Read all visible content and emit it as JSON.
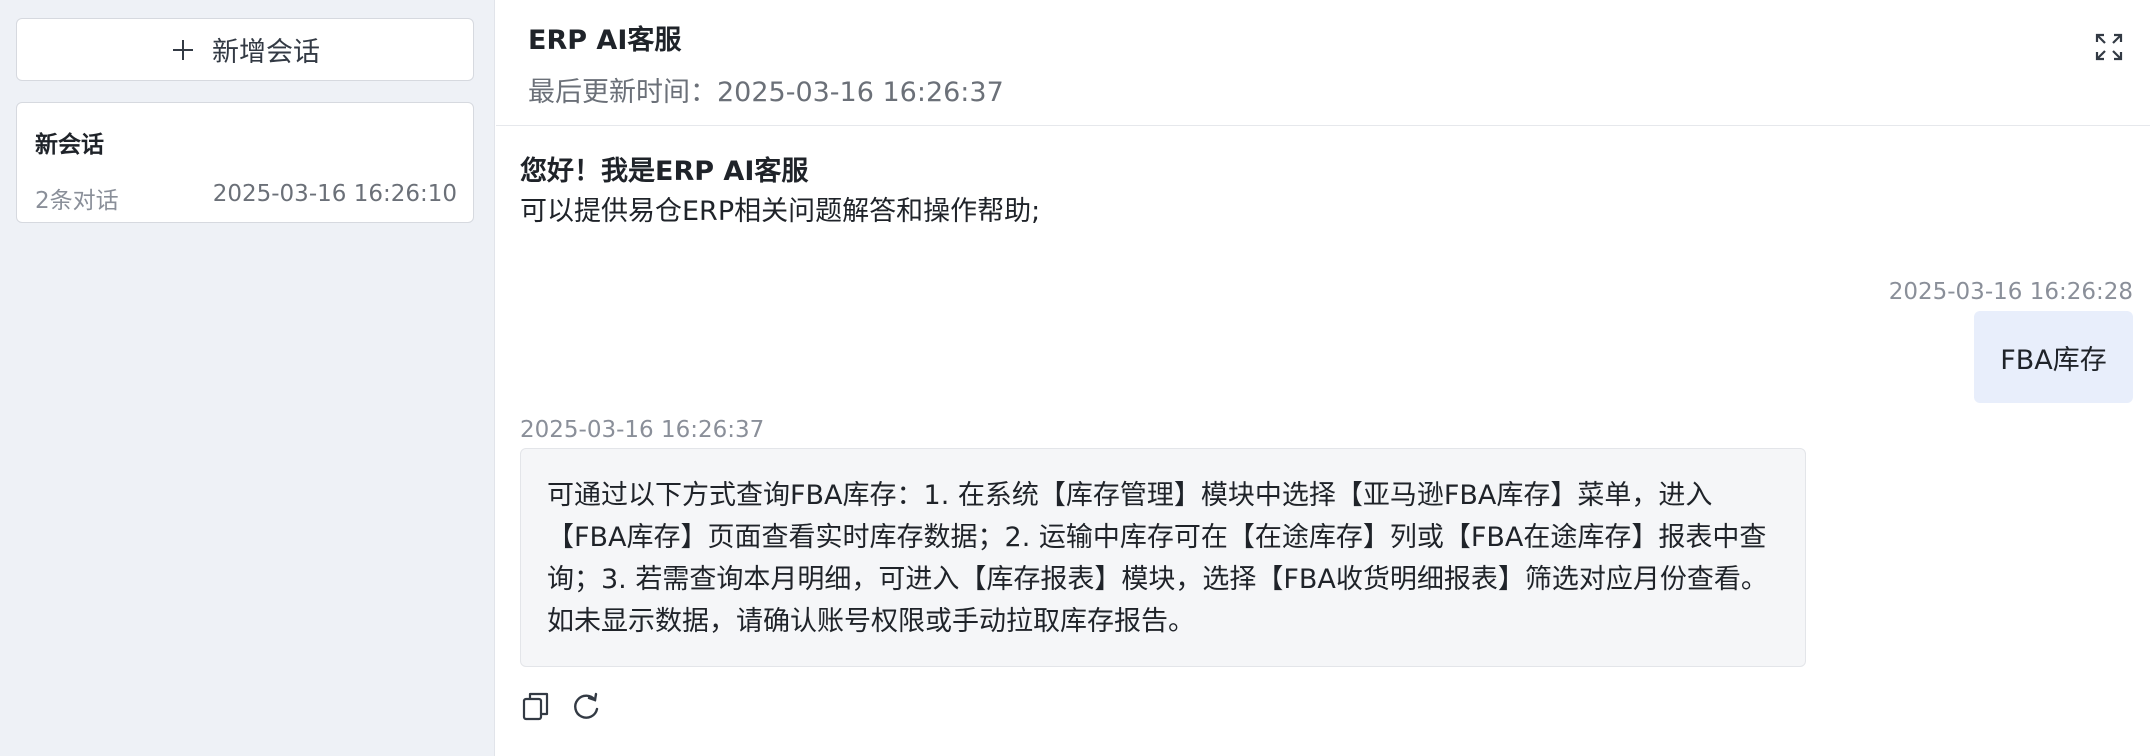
{
  "sidebar": {
    "new_chat_label": "新增会话",
    "sessions": [
      {
        "title": "新会话",
        "count_text": "2条对话",
        "time": "2025-03-16 16:26:10"
      }
    ]
  },
  "header": {
    "title": "ERP AI客服",
    "updated_label": "最后更新时间：",
    "updated_time": "2025-03-16 16:26:37"
  },
  "chat": {
    "greeting_title": "您好！我是ERP AI客服",
    "greeting_text": "可以提供易仓ERP相关问题解答和操作帮助;",
    "messages": [
      {
        "role": "user",
        "time": "2025-03-16 16:26:28",
        "text": "FBA库存"
      },
      {
        "role": "assistant",
        "time": "2025-03-16 16:26:37",
        "text": "可通过以下方式查询FBA库存：1. 在系统【库存管理】模块中选择【亚马逊FBA库存】菜单，进入【FBA库存】页面查看实时库存数据；2. 运输中库存可在【在途库存】列或【FBA在途库存】报表中查询；3. 若需查询本月明细，可进入【库存报表】模块，选择【FBA收货明细报表】筛选对应月份查看。如未显示数据，请确认账号权限或手动拉取库存报告。"
      }
    ]
  },
  "icons": {
    "new_chat": "plus-icon",
    "expand": "fullscreen-icon",
    "copy": "copy-icon",
    "regenerate": "refresh-icon"
  }
}
